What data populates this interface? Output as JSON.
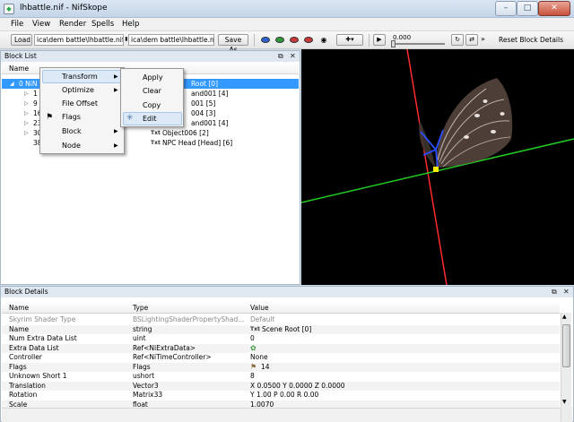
{
  "window": {
    "title": "lhbattle.nif - NifSkope",
    "minimize_glyph": "–",
    "maximize_glyph": "□",
    "close_glyph": "✕"
  },
  "menubar": {
    "items": [
      "File",
      "View",
      "Render",
      "Spells",
      "Help"
    ]
  },
  "toolbar": {
    "load_label": "Load",
    "load_path": "ica\\dem battle\\lhbattle.nif",
    "save_path": "ica\\dem battle\\lhbattle.nif",
    "save_as_label": "Save As",
    "time_value": "0.000",
    "overflow_glyph": "»",
    "reset_label": "Reset Block Details"
  },
  "block_list": {
    "title": "Block List",
    "column_name": "Name",
    "rows": [
      {
        "id": "0 NiN",
        "label": "Root [0]"
      },
      {
        "id": "1",
        "label": "and001 [4]"
      },
      {
        "id": "9",
        "label": "001 [5]"
      },
      {
        "id": "16",
        "label": "004 [3]"
      },
      {
        "id": "23",
        "label": "and001 [4]"
      },
      {
        "id": "30",
        "label": "Object006 [2]",
        "tag": "Txt"
      },
      {
        "id": "38",
        "label": "NPC Head [Head] [6]",
        "tag": "Txt"
      }
    ]
  },
  "context_menu": {
    "items": [
      "Transform",
      "Optimize",
      "File Offset",
      "Flags",
      "Block",
      "Node"
    ],
    "submenu": [
      "Apply",
      "Clear",
      "Copy",
      "Edit"
    ]
  },
  "viewport": {
    "colors": {
      "x_axis": "#ff2a2a",
      "y_axis": "#22cc22",
      "bone": "#2a4dff",
      "selection": "#ffee00"
    }
  },
  "block_details": {
    "title": "Block Details",
    "columns": [
      "Name",
      "Type",
      "Value"
    ],
    "rows": [
      {
        "name": "Skyrim Shader Type",
        "type": "BSLightingShaderPropertyShad...",
        "value": "Default",
        "dim": true
      },
      {
        "name": "Name",
        "type": "string",
        "value": "Scene Root [0]",
        "tag": "Txt"
      },
      {
        "name": "Num Extra Data List",
        "type": "uint",
        "value": "0"
      },
      {
        "name": "Extra Data List",
        "type": "Ref<NiExtraData>",
        "value": "",
        "icon": "extra-data-icon"
      },
      {
        "name": "Controller",
        "type": "Ref<NiTimeController>",
        "value": "None"
      },
      {
        "name": "Flags",
        "type": "Flags",
        "value": "14",
        "icon": "flag-icon"
      },
      {
        "name": "Unknown Short 1",
        "type": "ushort",
        "value": "8"
      },
      {
        "name": "Translation",
        "type": "Vector3",
        "value": "X 0.0500 Y 0.0000 Z 0.0000"
      },
      {
        "name": "Rotation",
        "type": "Matrix33",
        "value": "Y 1.00 P 0.00 R 0.00"
      },
      {
        "name": "Scale",
        "type": "float",
        "value": "1.0070"
      }
    ]
  }
}
